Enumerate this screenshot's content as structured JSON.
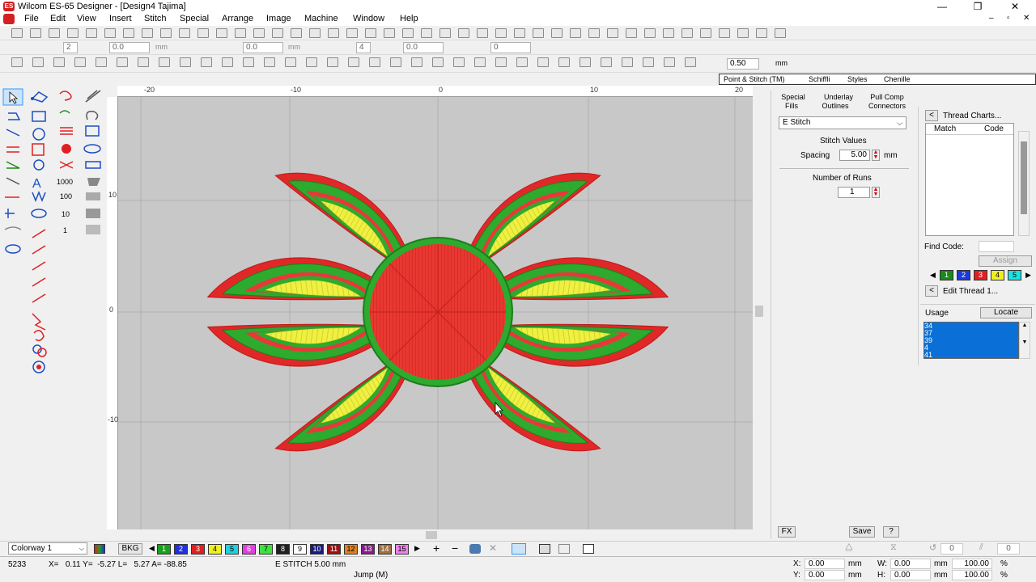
{
  "title_bar": {
    "app_title": "Wilcom ES-65 Designer - [Design4        Tajima]",
    "icon_text": "ES"
  },
  "menu": [
    "File",
    "Edit",
    "View",
    "Insert",
    "Stitch",
    "Special",
    "Arrange",
    "Image",
    "Machine",
    "Window",
    "Help"
  ],
  "toolbar2": {
    "field1": "2",
    "field2": "0.0",
    "unit1": "mm",
    "field3": "0.0",
    "unit2": "mm",
    "field4": "4",
    "field5": "0.0",
    "field6": "0"
  },
  "toolbar3": {
    "zoom_value": "0.50",
    "unit": "mm"
  },
  "right_tabs": [
    "Point & Stitch (TM)",
    "Schiffli",
    "Styles",
    "Chenille"
  ],
  "ruler_top": [
    "-20",
    "-10",
    "0",
    "10",
    "20"
  ],
  "ruler_left": [
    "10",
    "0",
    "-10"
  ],
  "props": {
    "tabs_row1": [
      "Special",
      "Underlay",
      "Pull Comp"
    ],
    "tabs_row2": [
      "Fills",
      "Outlines",
      "Connectors"
    ],
    "stitch_type": "E Stitch",
    "stitch_values_label": "Stitch Values",
    "spacing_label": "Spacing",
    "spacing_value": "5.00",
    "spacing_unit": "mm",
    "runs_label": "Number of Runs",
    "runs_value": "1",
    "fx_button": "FX",
    "save_button": "Save",
    "help_button": "?"
  },
  "thread_panel": {
    "thread_charts_label": "Thread Charts...",
    "col_match": "Match",
    "col_code": "Code",
    "find_code_label": "Find Code:",
    "assign_button": "Assign",
    "swatches": [
      {
        "n": "1",
        "color": "#1a8a1a"
      },
      {
        "n": "2",
        "color": "#1a3ae0"
      },
      {
        "n": "3",
        "color": "#e02020"
      },
      {
        "n": "4",
        "color": "#f0f020"
      },
      {
        "n": "5",
        "color": "#20e0e0"
      }
    ],
    "edit_thread_label": "Edit Thread 1...",
    "usage_label": "Usage",
    "locate_button": "Locate",
    "usage_items": [
      "34",
      "37",
      "39",
      "4",
      "41"
    ]
  },
  "bottom_bar": {
    "colorway": "Colorway 1",
    "bkg_label": "BKG",
    "palette": [
      {
        "n": "1",
        "color": "#18a018"
      },
      {
        "n": "2",
        "color": "#2030e0"
      },
      {
        "n": "3",
        "color": "#e02020"
      },
      {
        "n": "4",
        "color": "#f0f020"
      },
      {
        "n": "5",
        "color": "#20d0e0"
      },
      {
        "n": "6",
        "color": "#e040e0"
      },
      {
        "n": "7",
        "color": "#40e040"
      },
      {
        "n": "8",
        "color": "#202020"
      },
      {
        "n": "9",
        "color": "#ffffff"
      },
      {
        "n": "10",
        "color": "#1a1a80"
      },
      {
        "n": "11",
        "color": "#a01010"
      },
      {
        "n": "12",
        "color": "#e08020"
      },
      {
        "n": "13",
        "color": "#8a1a8a"
      },
      {
        "n": "14",
        "color": "#a07040"
      },
      {
        "n": "15",
        "color": "#f080f0"
      }
    ],
    "rotate_value": "0",
    "skew_value": "0"
  },
  "status": {
    "count": "5233",
    "coords": "X=   0.11 Y=  -5.27 L=   5.27 A= -88.85",
    "stitch_info": "E STITCH  5.00 mm",
    "jump": "Jump (M)",
    "x_label": "X:",
    "x_value": "0.00",
    "y_label": "Y:",
    "y_value": "0.00",
    "w_label": "W:",
    "w_value": "0.00",
    "h_label": "H:",
    "h_value": "0.00",
    "mm": "mm",
    "pct_w": "100.00",
    "pct_h": "100.00",
    "pct": "%"
  }
}
